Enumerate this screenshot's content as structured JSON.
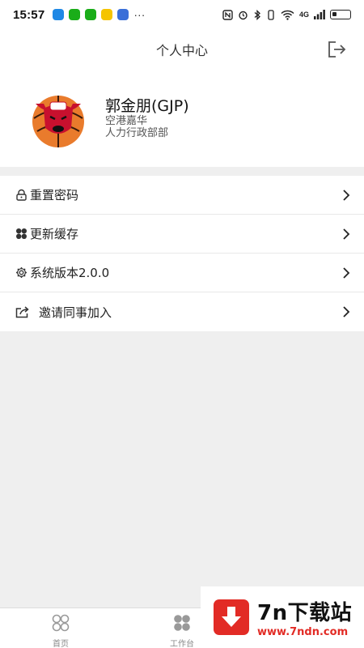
{
  "status": {
    "time": "15:57",
    "more": "···",
    "network": "4G",
    "notif_colors": [
      "#1e88e5",
      "#1aad19",
      "#1aad19",
      "#f5c400",
      "#3a6fd8"
    ]
  },
  "header": {
    "title": "个人中心",
    "logout_icon": "logout-icon"
  },
  "profile": {
    "name": "郭金朋(GJP)",
    "company": "空港嘉华",
    "department": "人力行政部部"
  },
  "menu": [
    {
      "label": "重置密码",
      "icon": "lock-icon"
    },
    {
      "label": "更新缓存",
      "icon": "clover-icon"
    },
    {
      "label": "系统版本2.0.0",
      "icon": "gear-icon"
    },
    {
      "label": "邀请同事加入",
      "icon": "share-icon"
    }
  ],
  "tabs": [
    {
      "label": "首页",
      "icon": "home-icon"
    },
    {
      "label": "工作台",
      "icon": "workbench-icon"
    }
  ],
  "watermark": {
    "title": "7n下载站",
    "url": "www.7ndn.com",
    "color": "#e22b25"
  }
}
